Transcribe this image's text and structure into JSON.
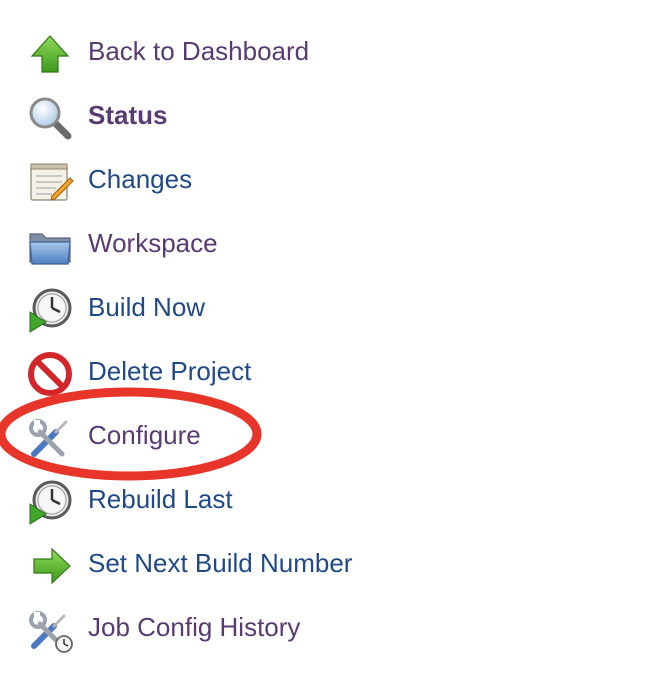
{
  "tasks": [
    {
      "label": "Back to Dashboard",
      "icon": "up-arrow-icon",
      "visited": true
    },
    {
      "label": "Status",
      "icon": "magnifier-icon",
      "visited": true,
      "bold": true
    },
    {
      "label": "Changes",
      "icon": "notepad-icon",
      "visited": false
    },
    {
      "label": "Workspace",
      "icon": "folder-icon",
      "visited": true
    },
    {
      "label": "Build Now",
      "icon": "clock-play-icon",
      "visited": false
    },
    {
      "label": "Delete Project",
      "icon": "no-entry-icon",
      "visited": false
    },
    {
      "label": "Configure",
      "icon": "wrench-screwdriver-icon",
      "visited": true
    },
    {
      "label": "Rebuild Last",
      "icon": "clock-play-icon",
      "visited": false
    },
    {
      "label": "Set Next Build Number",
      "icon": "right-arrow-icon",
      "visited": false
    },
    {
      "label": "Job Config History",
      "icon": "wrench-screwdriver-clock-icon",
      "visited": true
    }
  ],
  "colors": {
    "visited_link": "#5a3a73",
    "link": "#204a87",
    "highlight": "#e8352a"
  },
  "annotation": {
    "type": "ellipse",
    "target": "Configure"
  }
}
